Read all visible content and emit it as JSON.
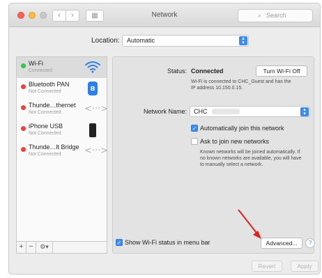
{
  "window": {
    "title": "Network"
  },
  "toolbar": {
    "back_glyph": "‹",
    "forward_glyph": "›",
    "grid_glyph": "▦",
    "search_placeholder": "Search",
    "search_glyph": "⌕"
  },
  "location": {
    "label": "Location:",
    "value": "Automatic"
  },
  "sidebar": {
    "items": [
      {
        "name": "Wi-Fi",
        "status": "Connected",
        "status_color": "#34c44d",
        "icon": "wifi-icon"
      },
      {
        "name": "Bluetooth PAN",
        "status": "Not Connected",
        "status_color": "#e8443a",
        "icon": "bluetooth-icon",
        "icon_text": "ʙ"
      },
      {
        "name": "Thunde…thernet",
        "status": "Not Connected",
        "status_color": "#e8443a",
        "icon": "thunderbolt-icon",
        "icon_text": "<···>"
      },
      {
        "name": "iPhone USB",
        "status": "Not Connected",
        "status_color": "#e8443a",
        "icon": "iphone-icon"
      },
      {
        "name": "Thunde…lt Bridge",
        "status": "Not Connected",
        "status_color": "#e8443a",
        "icon": "thunderbolt-bridge-icon",
        "icon_text": "<···>"
      }
    ],
    "add_label": "+",
    "remove_label": "−",
    "action_label": "⚙▾"
  },
  "detail": {
    "status_label": "Status:",
    "status_value": "Connected",
    "turn_off_label": "Turn Wi-Fi Off",
    "status_note_1": "Wi-Fi is connected to CHC_Guest and has the",
    "status_note_2": "IP address 10.150.0.15.",
    "network_name_label": "Network Name:",
    "network_name_value": "CHC",
    "auto_join_label": "Automatically join this network",
    "auto_join_checked": true,
    "ask_join_label": "Ask to join new networks",
    "ask_join_checked": false,
    "ask_note_1": "Known networks will be joined automatically. If",
    "ask_note_2": "no known networks are available, you will have",
    "ask_note_3": "to manually select a network.",
    "show_status_label": "Show Wi-Fi status in menu bar",
    "show_status_checked": true,
    "advanced_label": "Advanced...",
    "help_label": "?"
  },
  "footer": {
    "revert_label": "Revert",
    "apply_label": "Apply"
  },
  "colors": {
    "accent": "#3c8cf0",
    "annotation_arrow": "#e0201b"
  }
}
